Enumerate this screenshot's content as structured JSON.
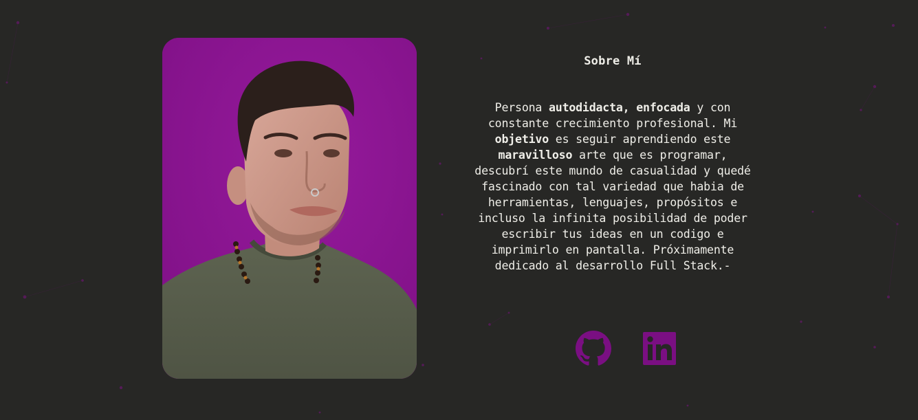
{
  "about": {
    "title": "Sobre Mí",
    "paragraph": [
      {
        "text": "Persona ",
        "bold": false
      },
      {
        "text": "autodidacta, enfocada",
        "bold": true
      },
      {
        "text": " y con constante crecimiento profesional. Mi ",
        "bold": false
      },
      {
        "text": "objetivo",
        "bold": true
      },
      {
        "text": " es seguir aprendiendo este ",
        "bold": false
      },
      {
        "text": "maravilloso",
        "bold": true
      },
      {
        "text": " arte que es programar, descubrí este mundo de casualidad y quedé fascinado con tal variedad que habia de herramientas, lenguajes, propósitos e incluso la infinita posibilidad de poder escribir tus ideas en un codigo e imprimirlo en pantalla. Próximamente dedicado al desarrollo Full Stack.-",
        "bold": false
      }
    ]
  },
  "profile_photo": {
    "icon": "portrait-photo",
    "background_color": "#8a1490"
  },
  "socials": [
    {
      "name": "GitHub",
      "icon": "github-icon",
      "color": "#7a0f82"
    },
    {
      "name": "LinkedIn",
      "icon": "linkedin-icon",
      "color": "#7a0f82"
    }
  ],
  "theme": {
    "background": "#272725",
    "text": "#efeee8",
    "accent": "#8a1490",
    "particle": "#6d1a70"
  }
}
